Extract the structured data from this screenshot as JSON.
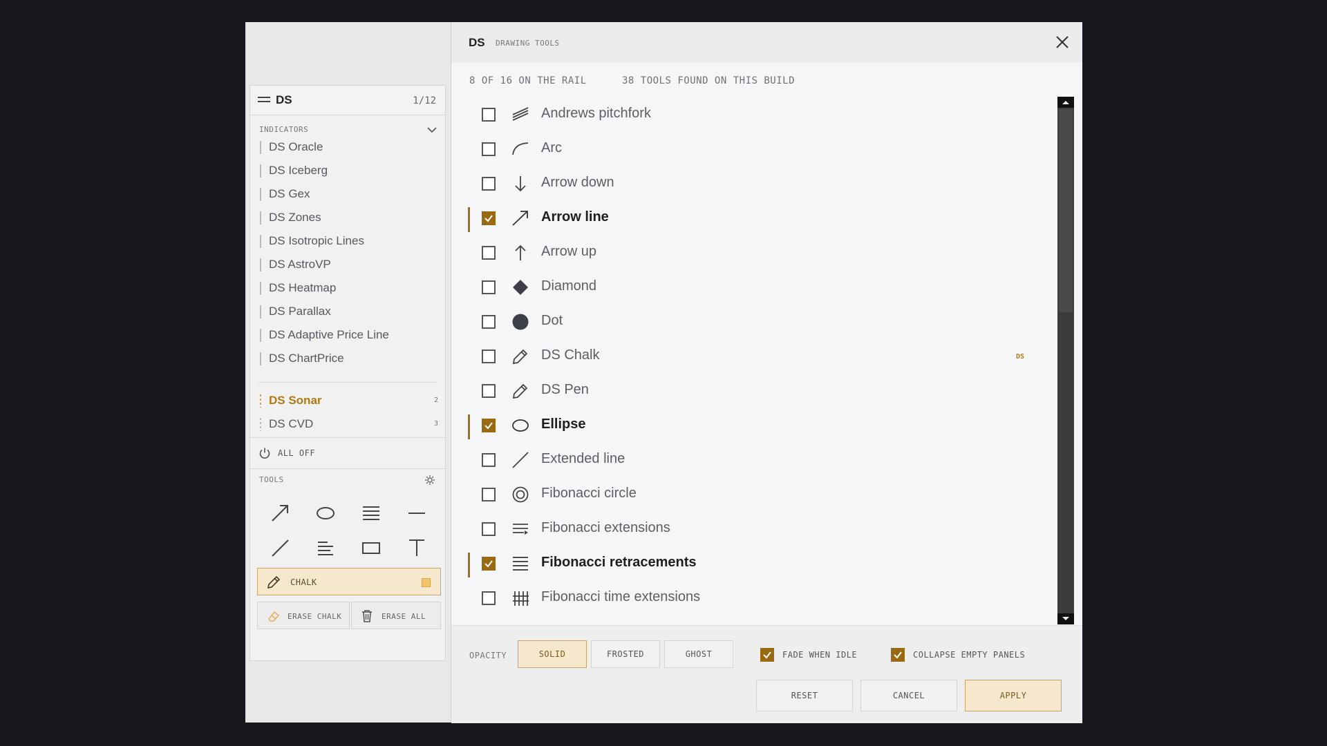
{
  "indicator_panel": {
    "title": "DS",
    "page": "1/12",
    "section_label": "INDICATORS",
    "items": [
      {
        "label": "DS Oracle"
      },
      {
        "label": "DS Iceberg"
      },
      {
        "label": "DS Gex"
      },
      {
        "label": "DS Zones"
      },
      {
        "label": "DS Isotropic Lines"
      },
      {
        "label": "DS AstroVP"
      },
      {
        "label": "DS Heatmap"
      },
      {
        "label": "DS Parallax"
      },
      {
        "label": "DS Adaptive Price Line"
      },
      {
        "label": "DS ChartPrice"
      }
    ],
    "extra_items": [
      {
        "label": "DS Sonar",
        "count": "2",
        "active": true
      },
      {
        "label": "DS CVD",
        "count": "3",
        "active": false
      }
    ],
    "all_off_label": "ALL OFF"
  },
  "tools_panel": {
    "label": "TOOLS",
    "icons": [
      "arrow-line-icon",
      "ellipse-icon",
      "fib-retracement-icon",
      "horizontal-line-icon",
      "trend-line-icon",
      "fib-extension-icon",
      "rectangle-icon",
      "text-icon"
    ],
    "chalk_label": "CHALK",
    "erase_chalk_label": "ERASE CHALK",
    "erase_all_label": "ERASE ALL",
    "colors": {
      "chalk_bg": "#f6e8cc",
      "chalk_swatch": "#f2c46d"
    }
  },
  "dialog": {
    "title": "DS",
    "subtitle": "DRAWING TOOLS",
    "status_rail": "8 OF 16 ON THE RAIL",
    "status_found": "38 TOOLS FOUND ON THIS BUILD",
    "tools": [
      {
        "name": "Andrews pitchfork",
        "icon": "pitchfork-icon",
        "checked": false
      },
      {
        "name": "Arc",
        "icon": "arc-icon",
        "checked": false
      },
      {
        "name": "Arrow down",
        "icon": "arrow-down-icon",
        "checked": false
      },
      {
        "name": "Arrow line",
        "icon": "arrow-line-icon",
        "checked": true
      },
      {
        "name": "Arrow up",
        "icon": "arrow-up-icon",
        "checked": false
      },
      {
        "name": "Diamond",
        "icon": "diamond-icon",
        "checked": false
      },
      {
        "name": "Dot",
        "icon": "dot-icon",
        "checked": false
      },
      {
        "name": "DS Chalk",
        "icon": "pencil-icon",
        "checked": false,
        "tag": "DS"
      },
      {
        "name": "DS Pen",
        "icon": "pen-icon",
        "checked": false
      },
      {
        "name": "Ellipse",
        "icon": "ellipse-icon",
        "checked": true
      },
      {
        "name": "Extended line",
        "icon": "extended-line-icon",
        "checked": false
      },
      {
        "name": "Fibonacci circle",
        "icon": "fib-circle-icon",
        "checked": false
      },
      {
        "name": "Fibonacci extensions",
        "icon": "fib-extensions-icon",
        "checked": false
      },
      {
        "name": "Fibonacci retracements",
        "icon": "fib-retracements-icon",
        "checked": true
      },
      {
        "name": "Fibonacci time extensions",
        "icon": "fib-time-icon",
        "checked": false
      }
    ],
    "opacity_label": "OPACITY",
    "opacity_options": [
      "SOLID",
      "FROSTED",
      "GHOST"
    ],
    "opacity_selected": "SOLID",
    "fade_when_idle": {
      "label": "FADE WHEN IDLE",
      "checked": true
    },
    "collapse_empty": {
      "label": "COLLAPSE EMPTY PANELS",
      "checked": true
    },
    "buttons": {
      "reset": "RESET",
      "cancel": "CANCEL",
      "apply": "APPLY"
    },
    "colors": {
      "accent": "#9a6a12",
      "selected_bg": "#f6e8cc",
      "scrollbar": "#3c3c3c"
    }
  }
}
